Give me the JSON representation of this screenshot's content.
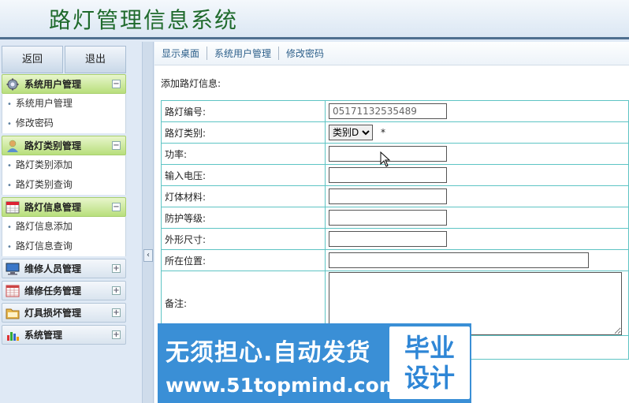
{
  "header": {
    "title": "路灯管理信息系统"
  },
  "sidebar": {
    "buttons": {
      "back": "返回",
      "logout": "退出"
    },
    "groups": [
      {
        "label": "系统用户管理",
        "icon": "gear-icon",
        "items": [
          "系统用户管理",
          "修改密码"
        ]
      },
      {
        "label": "路灯类别管理",
        "icon": "user-icon",
        "items": [
          "路灯类别添加",
          "路灯类别查询"
        ]
      },
      {
        "label": "路灯信息管理",
        "icon": "calendar-icon",
        "items": [
          "路灯信息添加",
          "路灯信息查询"
        ]
      },
      {
        "label": "维修人员管理",
        "icon": "monitor-icon",
        "items": []
      },
      {
        "label": "维修任务管理",
        "icon": "grid-icon",
        "items": []
      },
      {
        "label": "灯具损坏管理",
        "icon": "folder-icon",
        "items": []
      },
      {
        "label": "系统管理",
        "icon": "chart-icon",
        "items": []
      }
    ],
    "expanded_toggle": "−",
    "collapsed_toggle": "+",
    "collapse_arrow": "‹"
  },
  "tabs": [
    "显示桌面",
    "系统用户管理",
    "修改密码"
  ],
  "form": {
    "title": "添加路灯信息:",
    "fields": {
      "number": {
        "label": "路灯编号:",
        "value": "05171132535489"
      },
      "category": {
        "label": "路灯类别:",
        "selected": "类别D",
        "required_mark": "*"
      },
      "power": {
        "label": "功率:",
        "value": ""
      },
      "voltage": {
        "label": "输入电压:",
        "value": ""
      },
      "material": {
        "label": "灯体材料:",
        "value": ""
      },
      "protection": {
        "label": "防护等级:",
        "value": ""
      },
      "size": {
        "label": "外形尺寸:",
        "value": ""
      },
      "location": {
        "label": "所在位置:",
        "value": ""
      },
      "remark": {
        "label": "备注:",
        "value": ""
      }
    }
  },
  "watermark": {
    "line1": "无须担心.自动发货",
    "line2": "www.51topmind.com",
    "box_line1": "毕业",
    "box_line2": "设计"
  }
}
